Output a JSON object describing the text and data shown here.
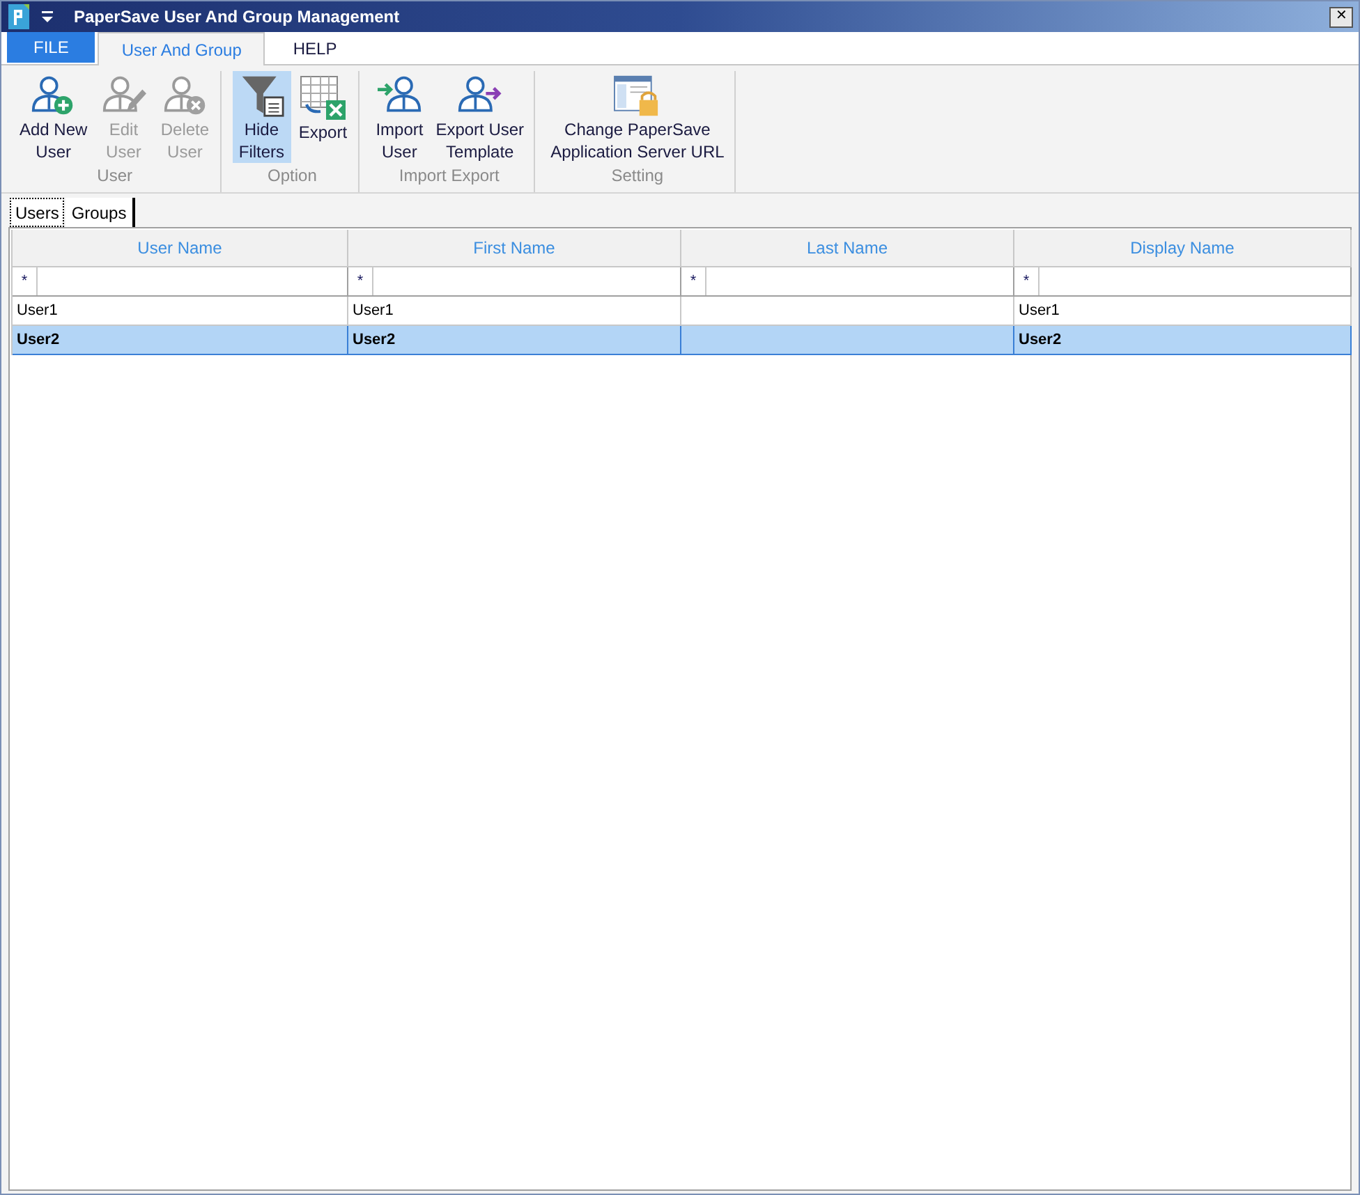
{
  "window": {
    "title": "PaperSave User And Group Management",
    "close": "✕"
  },
  "ribbon_tabs": [
    {
      "label": "FILE",
      "kind": "file",
      "selected": false
    },
    {
      "label": "User And Group",
      "kind": "tab",
      "selected": true
    },
    {
      "label": "HELP",
      "kind": "tab",
      "selected": false
    }
  ],
  "ribbon_groups": [
    {
      "label": "User",
      "buttons": [
        {
          "lines": [
            "Add New",
            "User"
          ],
          "kind": "add-user",
          "disabled": false,
          "selected": false
        },
        {
          "lines": [
            "Edit",
            "User"
          ],
          "kind": "edit-user",
          "disabled": true,
          "selected": false
        },
        {
          "lines": [
            "Delete",
            "User"
          ],
          "kind": "delete-user",
          "disabled": true,
          "selected": false
        }
      ]
    },
    {
      "label": "Option",
      "buttons": [
        {
          "lines": [
            "Hide",
            "Filters"
          ],
          "kind": "filter",
          "disabled": false,
          "selected": true
        },
        {
          "lines": [
            "Export"
          ],
          "kind": "export-grid",
          "disabled": false,
          "selected": false
        }
      ]
    },
    {
      "label": "Import Export",
      "buttons": [
        {
          "lines": [
            "Import",
            "User"
          ],
          "kind": "import-user",
          "disabled": false,
          "selected": false
        },
        {
          "lines": [
            "Export User",
            "Template"
          ],
          "kind": "export-user",
          "disabled": false,
          "selected": false
        }
      ]
    },
    {
      "label": "Setting",
      "buttons": [
        {
          "lines": [
            "Change PaperSave",
            "Application Server URL"
          ],
          "kind": "locked-window",
          "disabled": false,
          "selected": false
        }
      ]
    }
  ],
  "view_tabs": [
    {
      "label": "Users",
      "selected": true
    },
    {
      "label": "Groups",
      "selected": false
    }
  ],
  "table": {
    "columns": [
      "User Name",
      "First Name",
      "Last Name",
      "Display Name"
    ],
    "filter_row": [
      "*",
      "*",
      "*",
      "*"
    ],
    "rows": [
      {
        "cells": [
          "User1",
          "User1",
          "",
          "User1"
        ],
        "selected": false
      },
      {
        "cells": [
          "User2",
          "User2",
          "",
          "User2"
        ],
        "selected": true
      }
    ]
  }
}
